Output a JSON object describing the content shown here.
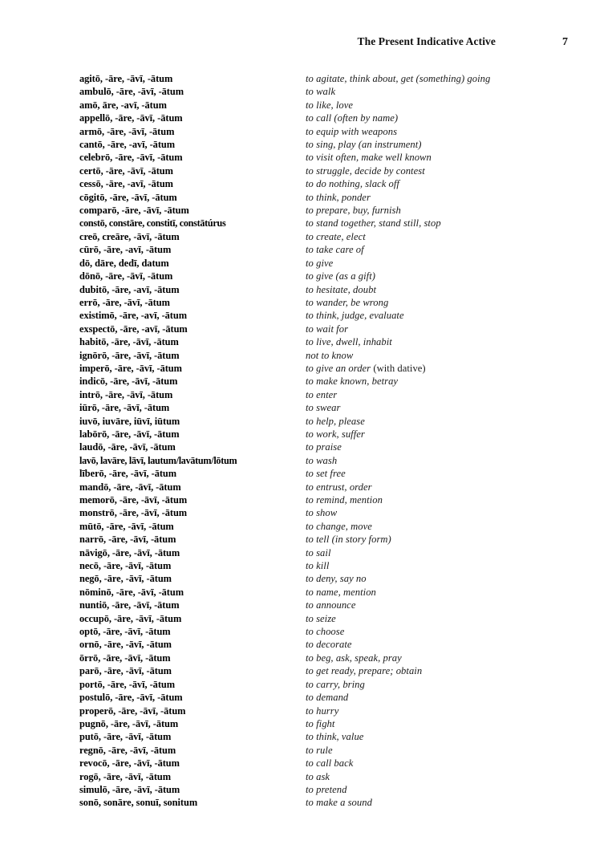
{
  "header": {
    "title": "The Present Indicative Active",
    "page_number": "7"
  },
  "entries": [
    {
      "principal_parts": "agitō, -āre, -āvī, -ātum",
      "meaning": "to agitate, think about, get (something) going"
    },
    {
      "principal_parts": "ambulō, -āre, -āvī, -ātum",
      "meaning": "to walk"
    },
    {
      "principal_parts": "amō, āre, -avī, -ātum",
      "meaning": "to like, love"
    },
    {
      "principal_parts": "appellō, -āre, -āvī, -ātum",
      "meaning": "to call (often by name)"
    },
    {
      "principal_parts": "armō, -āre, -āvī, -ātum",
      "meaning": "to equip with weapons"
    },
    {
      "principal_parts": "cantō, -āre, -avī, -ātum",
      "meaning": "to sing, play (an instrument)"
    },
    {
      "principal_parts": "celebrō, -āre, -āvī, -ātum",
      "meaning": "to visit often, make well known"
    },
    {
      "principal_parts": "certō, -āre, -āvī, -ātum",
      "meaning": "to struggle, decide by contest"
    },
    {
      "principal_parts": "cessō, -āre, -avī, -ātum",
      "meaning": "to do nothing, slack off"
    },
    {
      "principal_parts": "cōgitō, -āre, -āvī, -ātum",
      "meaning": "to think, ponder"
    },
    {
      "principal_parts": "comparō, -āre, -āvī, -ātum",
      "meaning": "to prepare, buy, furnish"
    },
    {
      "principal_parts": "constō, constāre, constitī, constātúrus",
      "meaning": "to stand together, stand still, stop",
      "long": true
    },
    {
      "principal_parts": "creō, creāre, -āvī, -ātum",
      "meaning": "to create, elect"
    },
    {
      "principal_parts": "cūrō, -āre, -avī, -ātum",
      "meaning": "to take care of"
    },
    {
      "principal_parts": "dō, dāre, dedī, datum",
      "meaning": "to give"
    },
    {
      "principal_parts": "dōnō, -āre, -āvī, -ātum",
      "meaning": "to give (as a gift)"
    },
    {
      "principal_parts": "dubitō, -āre, -avī, -ātum",
      "meaning": "to hesitate, doubt"
    },
    {
      "principal_parts": "errō, -āre, -āvī, -ātum",
      "meaning": "to wander, be wrong"
    },
    {
      "principal_parts": "existimō, -āre, -avī, -ātum",
      "meaning": "to think, judge, evaluate"
    },
    {
      "principal_parts": "exspectō, -āre, -avī, -ātum",
      "meaning": "to wait for"
    },
    {
      "principal_parts": "habitō, -āre, -āvī, -ātum",
      "meaning": "to live, dwell, inhabit"
    },
    {
      "principal_parts": "ignōrō, -āre, -āvī, -ātum",
      "meaning": "not to know"
    },
    {
      "principal_parts": "imperō, -āre, -āvī, -ātum",
      "meaning": "to give an order ",
      "meaning_roman": "(with dative)"
    },
    {
      "principal_parts": "indicō, -āre, -āvī, -ātum",
      "meaning": "to make known, betray"
    },
    {
      "principal_parts": "intrō, -āre, -āvī, -ātum",
      "meaning": "to enter"
    },
    {
      "principal_parts": "iūrō, -āre, -āvī, -ātum",
      "meaning": "to swear"
    },
    {
      "principal_parts": "iuvō, iuvāre, iūvī, iūtum",
      "meaning": "to help, please"
    },
    {
      "principal_parts": "labōrō, -āre, -āvī, -ātum",
      "meaning": "to work, suffer"
    },
    {
      "principal_parts": "laudō, -āre, -āvī, -ātum",
      "meaning": "to praise"
    },
    {
      "principal_parts": "lavō, lavāre, lāvī, lautum/lavātum/lōtum",
      "meaning": "to wash",
      "long": true
    },
    {
      "principal_parts": "līberō, -āre, -āvī, -ātum",
      "meaning": "to set free"
    },
    {
      "principal_parts": "mandō, -āre, -āvī, -ātum",
      "meaning": "to entrust, order"
    },
    {
      "principal_parts": "memorō, -āre, -āvī, -ātum",
      "meaning": "to remind, mention"
    },
    {
      "principal_parts": "monstrō, -āre, -āvī, -ātum",
      "meaning": "to show"
    },
    {
      "principal_parts": "mūtō, -āre, -āvī, -ātum",
      "meaning": "to change, move"
    },
    {
      "principal_parts": "narrō, -āre, -āvī, -ātum",
      "meaning": "to tell (in story form)"
    },
    {
      "principal_parts": "nāvigō, -āre, -āvī, -ātum",
      "meaning": "to sail"
    },
    {
      "principal_parts": "necō, -āre, -āvī, -ātum",
      "meaning": "to kill"
    },
    {
      "principal_parts": "negō, -āre, -āvī, -ātum",
      "meaning": "to deny, say no"
    },
    {
      "principal_parts": "nōminō, -āre, -āvī, -ātum",
      "meaning": "to name, mention"
    },
    {
      "principal_parts": "nuntiō, -āre, -āvī, -ātum",
      "meaning": "to announce"
    },
    {
      "principal_parts": "occupō, -āre, -āvī, -ātum",
      "meaning": "to seize"
    },
    {
      "principal_parts": "optō, -āre, -āvī, -ātum",
      "meaning": "to choose"
    },
    {
      "principal_parts": "ornō, -āre, -āvī, -ātum",
      "meaning": "to decorate"
    },
    {
      "principal_parts": "ōrrō, -āre, -āvī, -ātum",
      "meaning": "to beg, ask, speak, pray"
    },
    {
      "principal_parts": "parō, -āre, -āvī, -ātum",
      "meaning": "to get ready, prepare; obtain"
    },
    {
      "principal_parts": "portō, -āre, -āvī, -ātum",
      "meaning": "to carry, bring"
    },
    {
      "principal_parts": "postulō, -āre, -āvī, -ātum",
      "meaning": "to demand"
    },
    {
      "principal_parts": "properō, -āre, -āvī, -ātum",
      "meaning": "to hurry"
    },
    {
      "principal_parts": "pugnō, -āre, -āvī, -ātum",
      "meaning": "to fight"
    },
    {
      "principal_parts": "putō, -āre, -āvī, -ātum",
      "meaning": "to think, value"
    },
    {
      "principal_parts": "regnō, -āre, -āvī, -ātum",
      "meaning": "to rule"
    },
    {
      "principal_parts": "revocō, -āre, -āvī, -ātum",
      "meaning": "to call back"
    },
    {
      "principal_parts": "rogō, -āre, -āvī, -ātum",
      "meaning": "to ask"
    },
    {
      "principal_parts": "simulō, -āre, -āvī, -ātum",
      "meaning": "to pretend"
    },
    {
      "principal_parts": "sonō, sonāre, sonuī, sonitum",
      "meaning": "to make a sound"
    }
  ]
}
